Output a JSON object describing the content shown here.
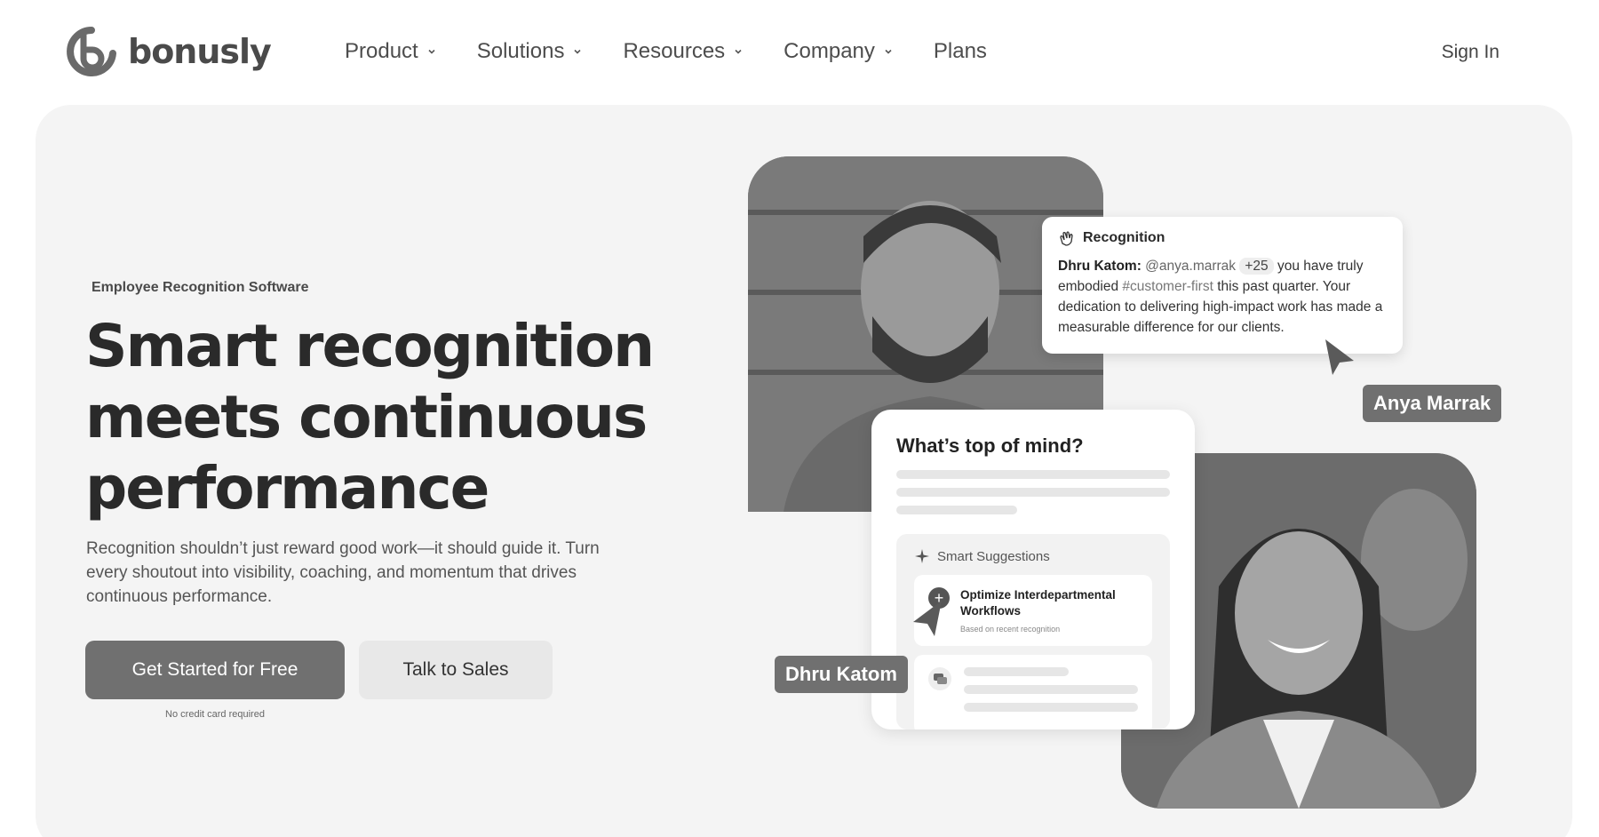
{
  "nav": {
    "logo_text": "bonusly",
    "items": [
      {
        "label": "Product",
        "has_dropdown": true
      },
      {
        "label": "Solutions",
        "has_dropdown": true
      },
      {
        "label": "Resources",
        "has_dropdown": true
      },
      {
        "label": "Company",
        "has_dropdown": true
      },
      {
        "label": "Plans",
        "has_dropdown": false
      }
    ],
    "sign_in": "Sign In"
  },
  "hero": {
    "eyebrow": "Employee Recognition Software",
    "headline": "Smart recognition meets continuous performance",
    "subtext": "Recognition shouldn’t just reward good work—it should guide it. Turn every shoutout into visibility, coaching, and momentum that drives continuous performance.",
    "cta_primary": "Get Started for Free",
    "cta_secondary": "Talk to Sales",
    "cta_note": "No credit card required"
  },
  "recognition_card": {
    "title": "Recognition",
    "sender": "Dhru Katom:",
    "mention": "@anya.marrak",
    "points": "+25",
    "text_1": "you have truly embodied",
    "hashtag": "#customer-first",
    "text_2": "this past quarter. Your dedication to delivering high-impact work has made a measurable difference for our clients."
  },
  "composer_card": {
    "title": "What’s top of mind?",
    "suggestions_label": "Smart Suggestions",
    "suggestion_title": "Optimize Interdepartmental Workflows",
    "suggestion_sub": "Based on recent recognition"
  },
  "name_tags": {
    "anya": "Anya Marrak",
    "dhru": "Dhru Katom"
  },
  "colors": {
    "button_primary": "#707070",
    "hero_bg": "#f4f4f4"
  }
}
